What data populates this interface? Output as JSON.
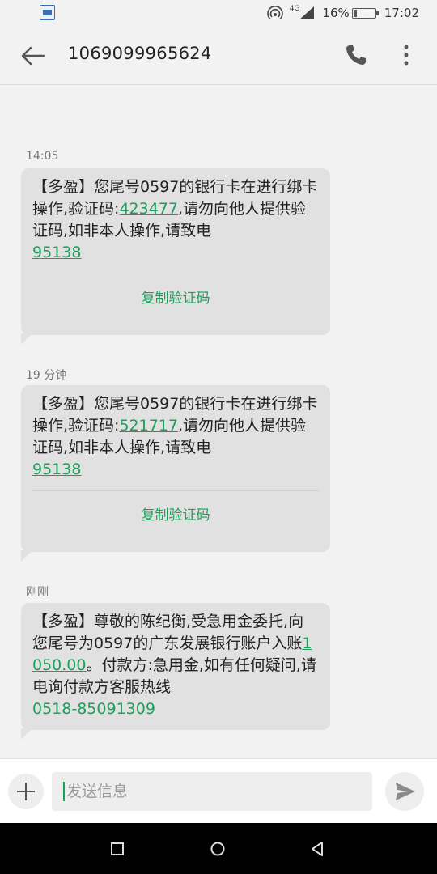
{
  "status_bar": {
    "network": "4G",
    "battery_percent": "16%",
    "battery_level": 0.16,
    "time": "17:02"
  },
  "header": {
    "title": "1069099965624",
    "back_icon": "arrow-left-icon",
    "call_icon": "phone-icon",
    "more_icon": "more-vertical-icon"
  },
  "messages": [
    {
      "timestamp": "14:05",
      "text_before": "【多盈】您尾号0597的银行卡在进行绑卡操作,验证码:",
      "code": "423477",
      "text_after": ",请勿向他人提供验证码,如非本人操作,请致电",
      "phone": "95138",
      "copy_label": "复制验证码"
    },
    {
      "timestamp": "19 分钟",
      "text_before": "【多盈】您尾号0597的银行卡在进行绑卡操作,验证码:",
      "code": "521717",
      "text_after": ",请勿向他人提供验证码,如非本人操作,请致电",
      "phone": "95138",
      "copy_label": "复制验证码"
    },
    {
      "timestamp": "刚刚",
      "text_before": "【多盈】尊敬的陈纪衡,受急用金委托,向您尾号为0597的广东发展银行账户入账",
      "amount": "1050.00",
      "text_after": "。付款方:急用金,如有任何疑问,请电询付款方客服热线",
      "phone": "0518-85091309"
    }
  ],
  "compose": {
    "placeholder": "发送信息",
    "add_icon": "plus-icon",
    "send_icon": "send-icon"
  },
  "nav": {
    "recent_icon": "square-icon",
    "home_icon": "circle-icon",
    "back_icon": "triangle-back-icon"
  },
  "colors": {
    "accent": "#1aa05a",
    "bubble": "#e1e1e1",
    "background": "#f2f2f2"
  }
}
